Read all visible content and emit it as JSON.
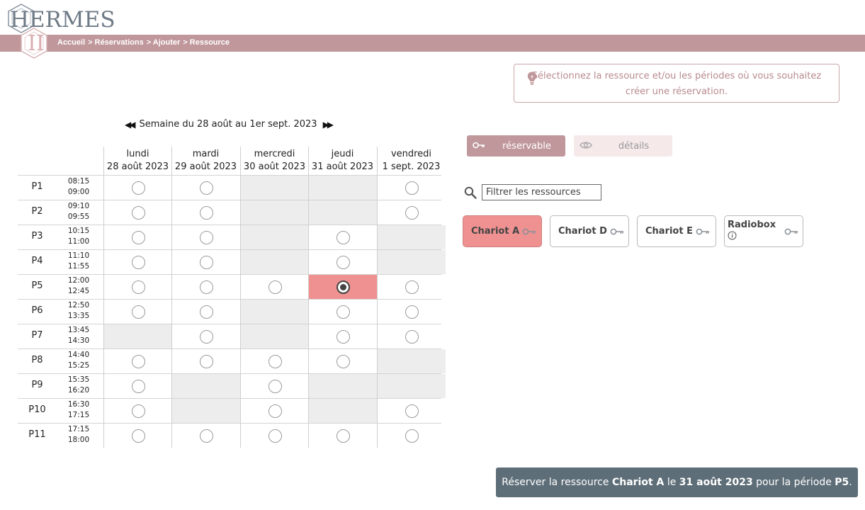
{
  "logo": {
    "title": "HERMES",
    "subtitle": "II"
  },
  "breadcrumb": [
    "Accueil",
    "> Réservations",
    "> Ajouter",
    "> Ressource"
  ],
  "hint": {
    "line1": "Sélectionnez la ressource et/ou les périodes où vous souhaitez",
    "line2": "créer une réservation."
  },
  "week": {
    "label": "Semaine du 28 août au 1er sept. 2023",
    "prev": "◀◀",
    "next": "▶▶"
  },
  "days": [
    {
      "name": "lundi",
      "date": "28 août 2023"
    },
    {
      "name": "mardi",
      "date": "29 août 2023"
    },
    {
      "name": "mercredi",
      "date": "30 août 2023"
    },
    {
      "name": "jeudi",
      "date": "31 août 2023"
    },
    {
      "name": "vendredi",
      "date": "1 sept. 2023"
    }
  ],
  "periods": [
    {
      "name": "P1",
      "start": "08:15",
      "end": "09:00",
      "slots": [
        "open",
        "open",
        "na",
        "na",
        "open"
      ]
    },
    {
      "name": "P2",
      "start": "09:10",
      "end": "09:55",
      "slots": [
        "open",
        "open",
        "na",
        "na",
        "open"
      ]
    },
    {
      "name": "P3",
      "start": "10:15",
      "end": "11:00",
      "slots": [
        "open",
        "open",
        "na",
        "open",
        "na"
      ]
    },
    {
      "name": "P4",
      "start": "11:10",
      "end": "11:55",
      "slots": [
        "open",
        "open",
        "na",
        "open",
        "na"
      ]
    },
    {
      "name": "P5",
      "start": "12:00",
      "end": "12:45",
      "slots": [
        "open",
        "open",
        "open",
        "selected",
        "open"
      ]
    },
    {
      "name": "P6",
      "start": "12:50",
      "end": "13:35",
      "slots": [
        "open",
        "open",
        "na",
        "open",
        "open"
      ]
    },
    {
      "name": "P7",
      "start": "13:45",
      "end": "14:30",
      "slots": [
        "na",
        "open",
        "na",
        "open",
        "open"
      ]
    },
    {
      "name": "P8",
      "start": "14:40",
      "end": "15:25",
      "slots": [
        "open",
        "open",
        "open",
        "open",
        "na"
      ]
    },
    {
      "name": "P9",
      "start": "15:35",
      "end": "16:20",
      "slots": [
        "open",
        "na",
        "open",
        "na",
        "na"
      ]
    },
    {
      "name": "P10",
      "start": "16:30",
      "end": "17:15",
      "slots": [
        "open",
        "na",
        "open",
        "na",
        "open"
      ]
    },
    {
      "name": "P11",
      "start": "17:15",
      "end": "18:00",
      "slots": [
        "open",
        "open",
        "open",
        "open",
        "open"
      ]
    }
  ],
  "tabs": {
    "reservable": "réservable",
    "details": "détails"
  },
  "filter": {
    "placeholder": "Filtrer les ressources"
  },
  "resources": [
    {
      "name": "Chariot A",
      "selected": true
    },
    {
      "name": "Chariot D",
      "selected": false
    },
    {
      "name": "Chariot E",
      "selected": false
    },
    {
      "name": "Radiobox",
      "selected": false
    }
  ],
  "action": {
    "p1": "Réserver la ressource ",
    "resource": "Chariot A",
    "p2": " le ",
    "date": "31 août 2023",
    "p3": " pour la période ",
    "period": "P5",
    "p4": "."
  },
  "colors": {
    "accent": "#c0979b",
    "selected": "#ef9191",
    "unavailable": "#ededed",
    "action": "#5e6e78"
  }
}
